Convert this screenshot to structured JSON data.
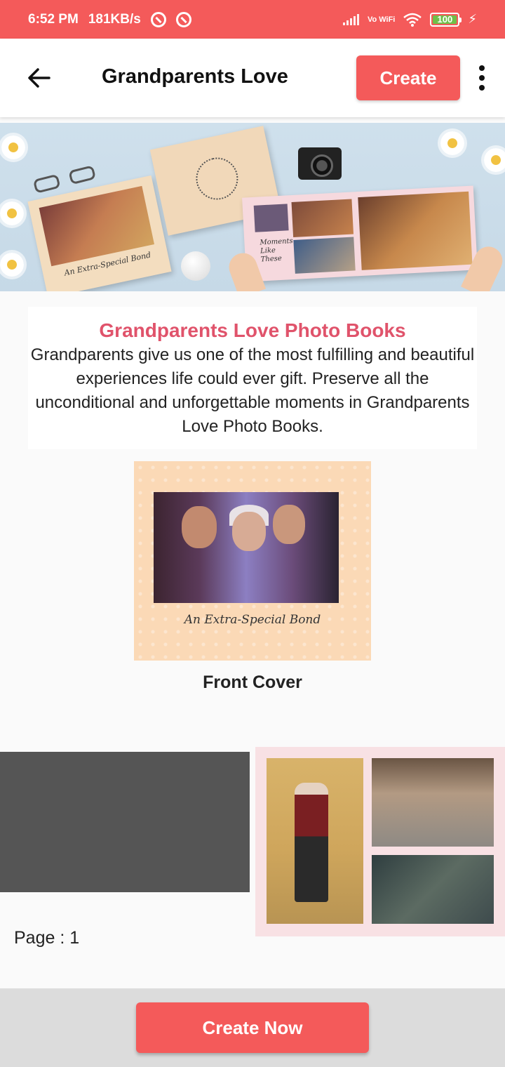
{
  "status_bar": {
    "time": "6:52 PM",
    "speed": "181KB/s",
    "network": "Vo WiFi",
    "battery": "100"
  },
  "app_bar": {
    "title": "Grandparents Love",
    "create_label": "Create"
  },
  "description": {
    "title": "Grandparents Love Photo Books",
    "body": "Grandparents give us one of the most fulfilling and beautiful experiences life could ever gift. Preserve all the unconditional and unforgettable moments in Grandparents Love Photo Books."
  },
  "banner": {
    "book_caption": "An Extra-Special Bond",
    "spread_caption": "Moments Like These"
  },
  "front_cover": {
    "caption": "An Extra-Special Bond",
    "label": "Front Cover"
  },
  "pages": {
    "label": "Page : 1"
  },
  "bottom": {
    "create_now_label": "Create Now"
  },
  "colors": {
    "accent": "#f45a5a",
    "title_pink": "#e0536b"
  }
}
